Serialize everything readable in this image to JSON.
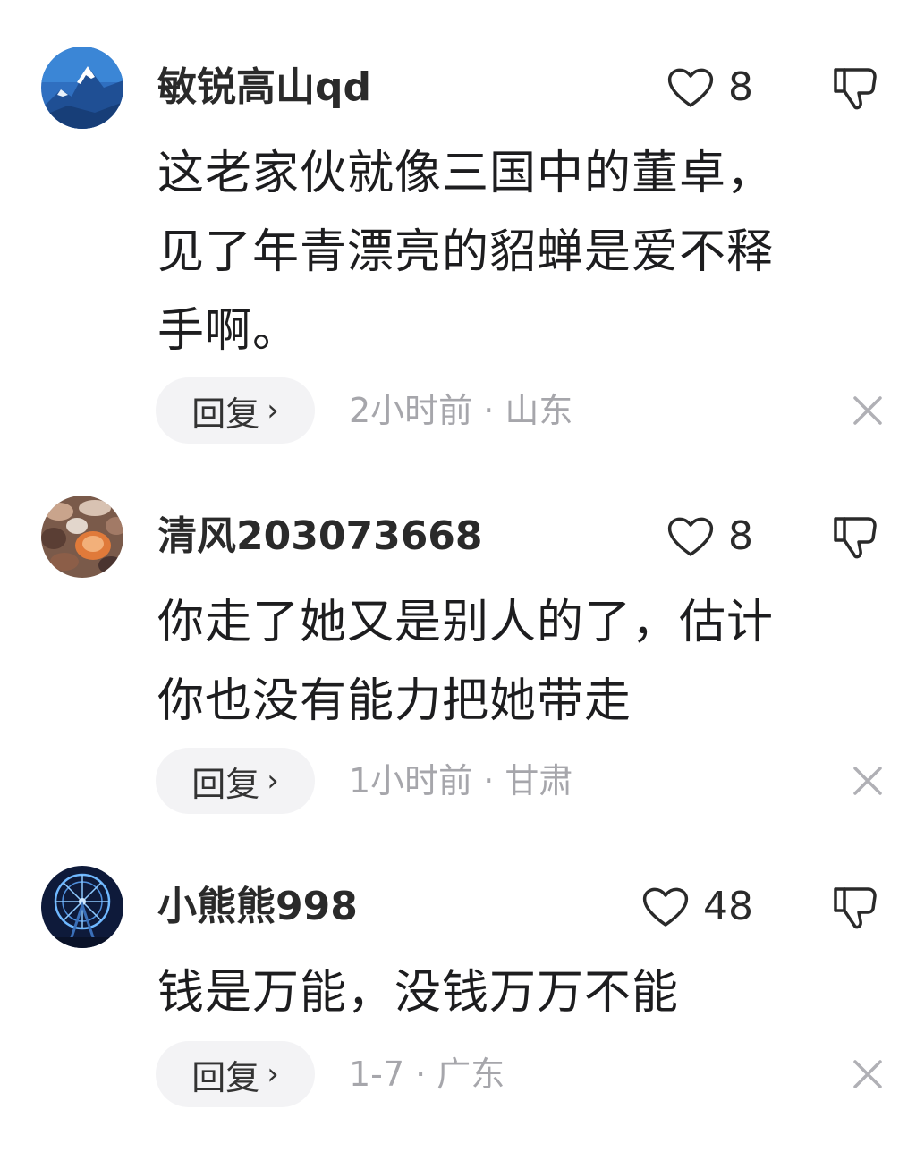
{
  "comments": [
    {
      "username": "敏锐高山qd",
      "likes": "8",
      "lines": [
        "这老家伙就像三国中的董卓，",
        "见了年青漂亮的貂蝉是爱不释",
        "手啊。"
      ],
      "reply_label": "回复",
      "reply_chevron": "›",
      "meta": "2小时前 · 山东",
      "avatar_icon": "snow-mountain-avatar-icon"
    },
    {
      "username": "清风203073668",
      "likes": "8",
      "lines": [
        "你走了她又是别人的了，估计",
        "你也没有能力把她带走"
      ],
      "reply_label": "回复",
      "reply_chevron": "›",
      "meta": "1小时前 · 甘肃",
      "avatar_icon": "pebbles-avatar-icon"
    },
    {
      "username": "小熊熊998",
      "likes": "48",
      "lines": [
        "钱是万能，没钱万万不能"
      ],
      "reply_label": "回复",
      "reply_chevron": "›",
      "meta": "1-7 · 广东",
      "avatar_icon": "ferris-wheel-avatar-icon"
    }
  ],
  "colors": {
    "text": "#1d1d1f",
    "meta": "#a6a6ab",
    "reply_bg": "#f3f3f5",
    "icon_stroke": "#2a2a2a"
  }
}
